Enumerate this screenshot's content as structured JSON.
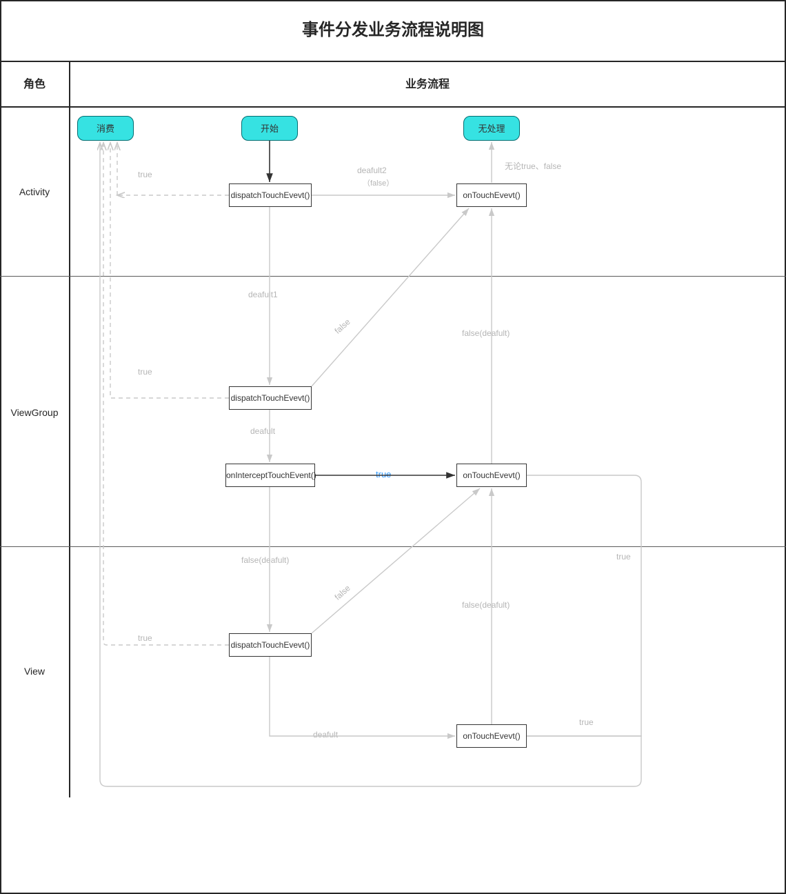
{
  "title": "事件分发业务流程说明图",
  "header": {
    "role": "角色",
    "flow": "业务流程"
  },
  "lanes": {
    "activity": "Activity",
    "viewgroup": "ViewGroup",
    "view": "View"
  },
  "nodes": {
    "consume": "消费",
    "start": "开始",
    "nohandle": "无处理",
    "a_dispatch": "dispatchTouchEvevt()",
    "a_ontouch": "onTouchEvevt()",
    "vg_dispatch": "dispatchTouchEvevt()",
    "vg_intercept": "onInterceptTouchEvent()",
    "vg_ontouch": "onTouchEvevt()",
    "v_dispatch": "dispatchTouchEvevt()",
    "v_ontouch": "onTouchEvevt()"
  },
  "edges": {
    "start_to_dispatch": "",
    "a_dispatch_to_ontouch": "deafult2",
    "a_dispatch_to_ontouch_sub": "（false）",
    "a_ontouch_to_nohandle": "无论true、false",
    "a_dispatch_true": "true",
    "a_dispatch_down": "deafult1",
    "vg_dispatch_true": "true",
    "vg_dispatch_false_up": "false",
    "vg_dispatch_to_intercept": "deafult",
    "vg_intercept_true": "true",
    "vg_intercept_false_down": "false(deafult)",
    "vg_ontouch_false_up": "false(deafult)",
    "vg_ontouch_true": "true",
    "v_dispatch_true": "true",
    "v_dispatch_false_up": "false",
    "v_dispatch_to_ontouch": "deafult",
    "v_ontouch_false_up": "false(deafult)",
    "v_ontouch_true": "true"
  }
}
